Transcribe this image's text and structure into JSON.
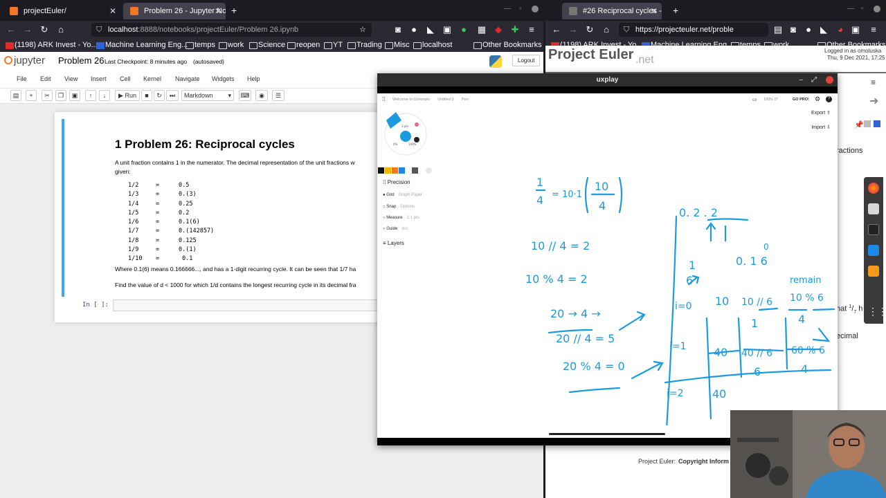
{
  "left_browser": {
    "tabs": [
      {
        "title": "projectEuler/",
        "active": false
      },
      {
        "title": "Problem 26 - Jupyter No",
        "active": true
      }
    ],
    "url_host": "localhost",
    "url_path": ":8888/notebooks/projectEuler/Problem 26.ipynb",
    "bookmarks": [
      "(1198) ARK Invest - Yo...",
      "Machine Learning Eng...",
      "temps",
      "work",
      "Science",
      "reopen",
      "YT",
      "Trading",
      "Misc",
      "localhost",
      "Other Bookmarks"
    ]
  },
  "jupyter": {
    "logo": "jupyter",
    "notebook_name": "Problem 26",
    "checkpoint": "Last Checkpoint: 8 minutes ago",
    "autosave": "(autosaved)",
    "logout": "Logout",
    "menu": [
      "File",
      "Edit",
      "View",
      "Insert",
      "Cell",
      "Kernel",
      "Navigate",
      "Widgets",
      "Help"
    ],
    "run_label": "Run",
    "cell_type": "Markdown",
    "title": "1  Problem 26: Reciprocal cycles",
    "intro": "A unit fraction contains 1 in the numerator. The decimal representation of the unit fractions w",
    "intro2": "given:",
    "fractions": [
      {
        "f": "1/2",
        "eq": "=",
        "v": "0.5"
      },
      {
        "f": "1/3",
        "eq": "=",
        "v": "0.(3)"
      },
      {
        "f": "1/4",
        "eq": "=",
        "v": "0.25"
      },
      {
        "f": "1/5",
        "eq": "=",
        "v": "0.2"
      },
      {
        "f": "1/6",
        "eq": "=",
        "v": "0.1(6)"
      },
      {
        "f": "1/7",
        "eq": "=",
        "v": "0.(142857)"
      },
      {
        "f": "1/8",
        "eq": "=",
        "v": "0.125"
      },
      {
        "f": "1/9",
        "eq": "=",
        "v": "0.(1)"
      },
      {
        "f": "1/10",
        "eq": "=",
        "v": "0.1"
      }
    ],
    "where_text": "Where 0.1(6) means 0.166666..., and has a 1-digit recurring cycle. It can be seen that 1/7 ha",
    "find_text": "Find the value of d < 1000 for which 1/d contains the longest recurring cycle in its decimal fra",
    "in_prompt": "In [ ]:"
  },
  "right_browser": {
    "tab_title": "#26 Reciprocal cycles - P",
    "url": "https://projecteuler.net/proble",
    "bookmarks": [
      "(1198) ARK Invest - Yo...",
      "Machine Learning Eng...",
      "temps",
      "work",
      "Other Bookmarks"
    ],
    "logo_main": "Project Euler",
    "logo_sub": ".net",
    "logged_in": "Logged in as omoluska",
    "date": "Thu, 9 Dec 2021, 17:25",
    "side_text_fractions": "ractions",
    "side_text_that": "hat",
    "side_sup": "1",
    "side_sub": "7",
    "side_text_h": "h",
    "side_text_decimal": "ecimal",
    "footer_label": "Project Euler:",
    "footer_link": "Copyright Inform"
  },
  "uxplay": {
    "window_title": "uxplay",
    "tabs": [
      "Welcome to Concepts",
      "Untitled 3",
      "Pen"
    ],
    "zoom": "100%",
    "angle": "0°",
    "go_pro": "GO PRO!",
    "export": "Export",
    "import": "Import",
    "tool_size": "3 pts",
    "tool_opacity_a": "0%",
    "tool_opacity_b": "100%",
    "precision": "Precision",
    "options": [
      {
        "name": "Grid",
        "value": "Graph Paper",
        "on": true
      },
      {
        "name": "Snap",
        "value": "Options",
        "on": false
      },
      {
        "name": "Measure",
        "value": "1:1 pts",
        "on": false
      },
      {
        "name": "Guide",
        "value": "Arc",
        "on": false
      }
    ],
    "layers": "Layers",
    "swatches": [
      "#111111",
      "#f5b400",
      "#f07a1a",
      "#1e88e5",
      "#555555",
      "#e8e8e8"
    ],
    "pen_color": "#1a9be0"
  },
  "handwriting": {
    "frac_1_4": "1",
    "frac_den": "4",
    "eq_10x": "= 10·1",
    "paren_num": "10",
    "paren_den": "4",
    "l1": "10 // 4   = 2",
    "l2": "10 % 4   = 2",
    "l3": "20 → 4 →",
    "l4": "20 // 4  = 5",
    "l5": "20 % 4 = 0",
    "dec1": "0. 2 . 2",
    "dec_sub": "0",
    "dec2": "0. 1 6",
    "note_1": "1",
    "note_6": "6",
    "remainder": "remain",
    "col_i0": "i=0",
    "col_i1": "i=1",
    "col_i2": "i=2",
    "t_10": "10",
    "t_10div6": "10 // 6",
    "t_1": "1",
    "t_10mod6": "10 % 6",
    "t_4": "4",
    "t_40": "40",
    "t_40div6": "40 // 6",
    "t_6": "6",
    "t_60mod6": "60 % 6",
    "t_4b": "4",
    "t_40b": "40"
  }
}
